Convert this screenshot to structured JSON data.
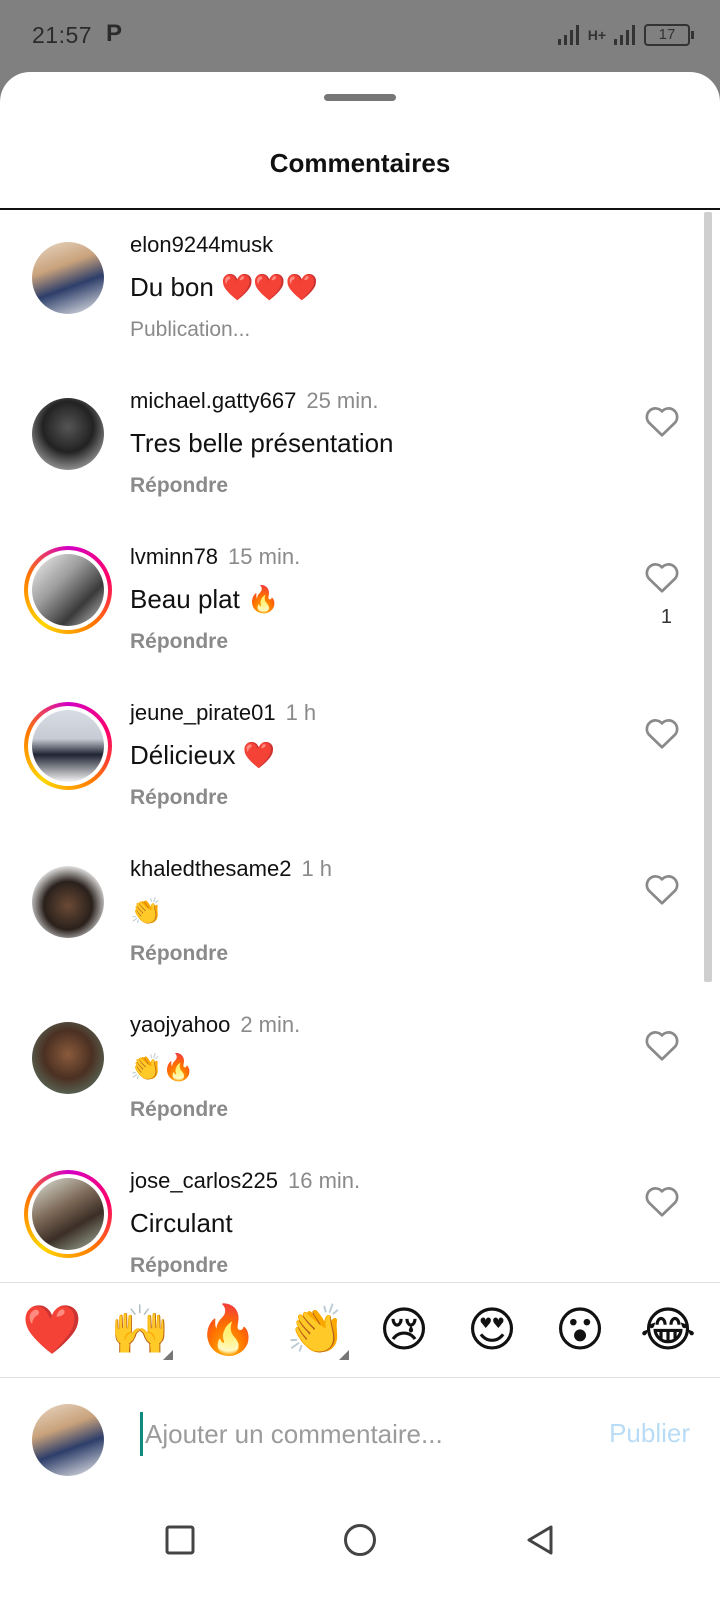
{
  "status_bar": {
    "time": "21:57",
    "app_indicator": "P",
    "network": "H+",
    "battery": "17"
  },
  "sheet": {
    "title": "Commentaires"
  },
  "comments": [
    {
      "username": "elon9244musk",
      "time": "",
      "text": "Du bon ❤️❤️❤️",
      "action": "Publication...",
      "likes": "",
      "avatar": "person-patterned-shirt"
    },
    {
      "username": "michael.gatty667",
      "time": "25 min.",
      "text": "Tres belle présentation",
      "action": "Répondre",
      "likes": "",
      "avatar": "person-black-hood"
    },
    {
      "username": "lvminn78",
      "time": "15 min.",
      "text": "Beau plat 🔥",
      "action": "Répondre",
      "likes": "1",
      "avatar": "person-bw-photo"
    },
    {
      "username": "jeune_pirate01",
      "time": "1 h",
      "text": "Délicieux ❤️",
      "action": "Répondre",
      "likes": "",
      "avatar": "person-suit"
    },
    {
      "username": "khaledthesame2",
      "time": "1 h",
      "text": "👏",
      "action": "Répondre",
      "likes": "",
      "avatar": "person-cap"
    },
    {
      "username": "yaojyahoo",
      "time": "2 min.",
      "text": "👏🔥",
      "action": "Répondre",
      "likes": "",
      "avatar": "person-portrait"
    },
    {
      "username": "jose_carlos225",
      "time": "16 min.",
      "text": "Circulant",
      "action": "Répondre",
      "likes": "",
      "avatar": "person-headband"
    }
  ],
  "emoji_bar": [
    "❤️",
    "🙌",
    "🔥",
    "👏",
    "😢",
    "😍",
    "😮",
    "😂"
  ],
  "composer": {
    "placeholder": "Ajouter un commentaire...",
    "publish_label": "Publier"
  },
  "icons": {
    "like": "heart-outline-icon",
    "nav_recents": "square-icon",
    "nav_home": "circle-icon",
    "nav_back": "triangle-back-icon"
  }
}
